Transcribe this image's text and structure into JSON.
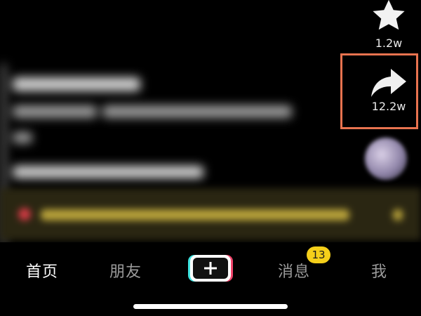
{
  "actions": {
    "favorite": {
      "icon": "star-icon",
      "count": "1.2w"
    },
    "share": {
      "icon": "share-arrow-icon",
      "count": "12.2w",
      "highlight_color": "#e8734f"
    }
  },
  "nav": {
    "items": [
      {
        "label": "首页",
        "active": true
      },
      {
        "label": "朋友",
        "active": false
      },
      {
        "label": "消息",
        "active": false,
        "badge": "13"
      },
      {
        "label": "我",
        "active": false
      }
    ],
    "create_icon": "plus-icon"
  },
  "colors": {
    "background": "#000000",
    "nav_active": "#ffffff",
    "nav_inactive": "#9b9b9b",
    "badge": "#f5cf1a",
    "accent_cyan": "#3fe3e0",
    "accent_red": "#f0446b"
  }
}
